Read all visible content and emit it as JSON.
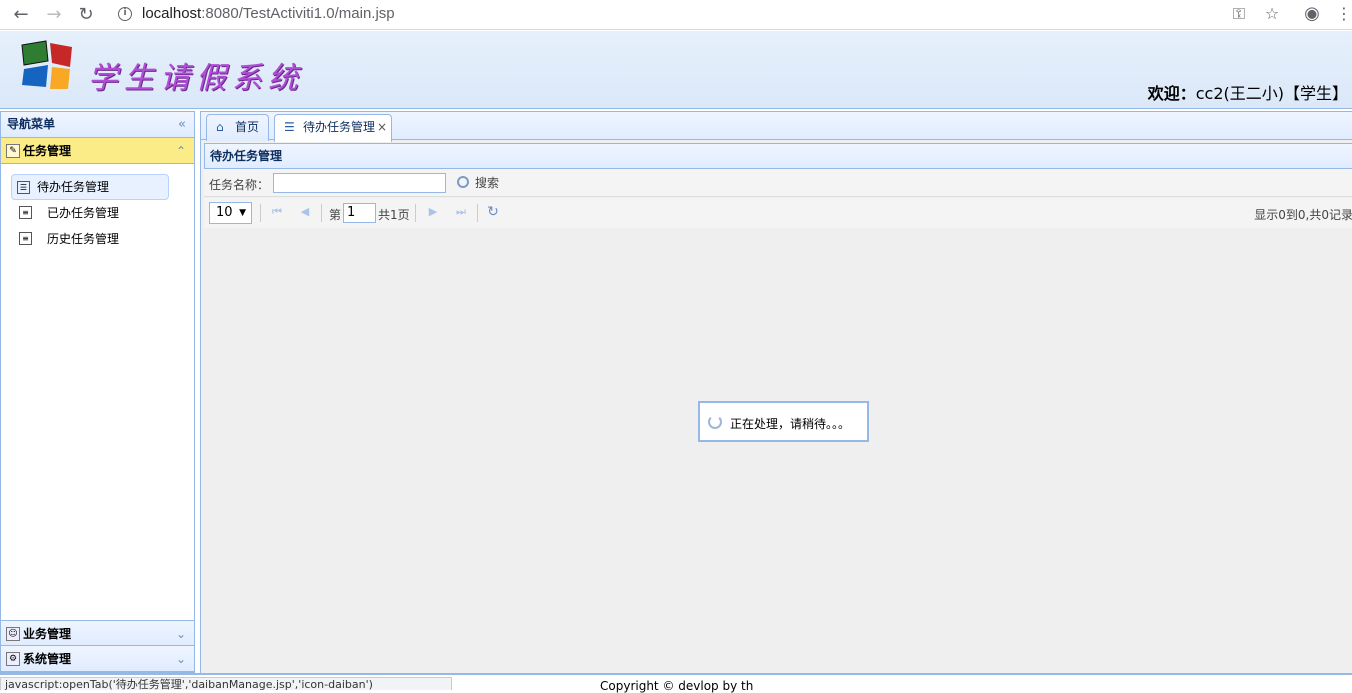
{
  "browser": {
    "url_host": "localhost",
    "url_rest": ":8080/TestActiviti1.0/main.jsp",
    "back_icon": "arrow-left-icon",
    "forward_icon": "arrow-right-icon",
    "reload_icon": "reload-icon"
  },
  "header": {
    "logo_text": "学生请假系统",
    "welcome_label": "欢迎：",
    "welcome_user": "cc2(王二小)【学生】"
  },
  "nav": {
    "title": "导航菜单",
    "sections": [
      {
        "label": "任务管理",
        "selected": true
      },
      {
        "label": "业务管理",
        "selected": false
      },
      {
        "label": "系统管理",
        "selected": false
      }
    ],
    "items": [
      {
        "label": "待办任务管理",
        "selected": true
      },
      {
        "label": "已办任务管理",
        "selected": false
      },
      {
        "label": "历史任务管理",
        "selected": false
      }
    ]
  },
  "tabs": [
    {
      "label": "首页",
      "active": false
    },
    {
      "label": "待办任务管理",
      "active": true,
      "close": "×"
    }
  ],
  "main": {
    "panel_title": "待办任务管理",
    "search_label": "任务名称：",
    "search_value": "",
    "search_button": "搜索",
    "page_size": "10",
    "page_prefix": "第",
    "page_number": "1",
    "page_total": "共1页",
    "pager_info": "显示0到0,共0记录",
    "loading_text": "正在处理，请稍待。。。"
  },
  "footer": {
    "status_text": "javascript:openTab('待办任务管理','daibanManage.jsp','icon-daiban')",
    "copyright": "Copyright © devlop by th"
  }
}
